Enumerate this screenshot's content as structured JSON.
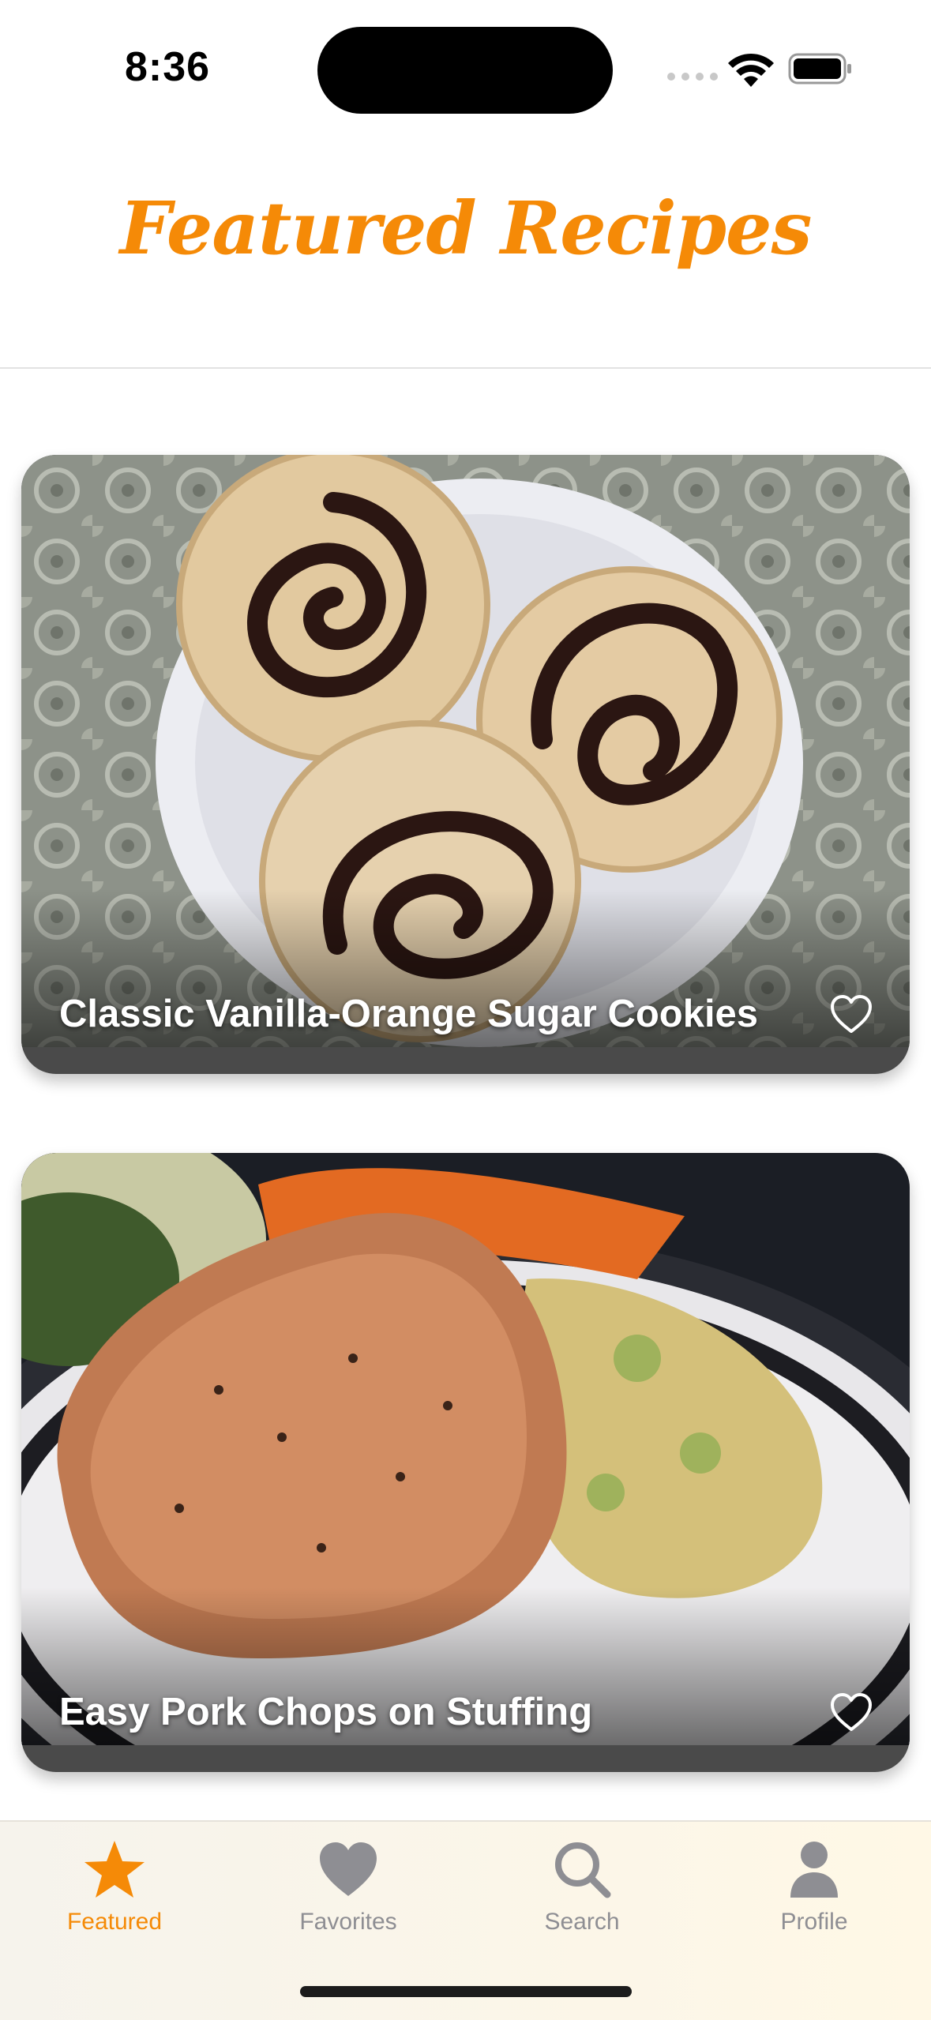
{
  "status_bar": {
    "time": "8:36"
  },
  "header": {
    "title": "Featured Recipes"
  },
  "recipes": [
    {
      "title": "Classic Vanilla-Orange Sugar Cookies",
      "favorite": false,
      "image": "sugar-cookies-photo"
    },
    {
      "title": "Easy Pork Chops on Stuffing",
      "favorite": false,
      "image": "pork-chops-photo"
    }
  ],
  "tab_bar": {
    "tabs": [
      {
        "label": "Featured",
        "icon": "star-icon",
        "active": true
      },
      {
        "label": "Favorites",
        "icon": "heart-icon",
        "active": false
      },
      {
        "label": "Search",
        "icon": "search-icon",
        "active": false
      },
      {
        "label": "Profile",
        "icon": "person-icon",
        "active": false
      }
    ]
  },
  "colors": {
    "accent": "#F58A07",
    "inactive": "#8E8E93"
  }
}
